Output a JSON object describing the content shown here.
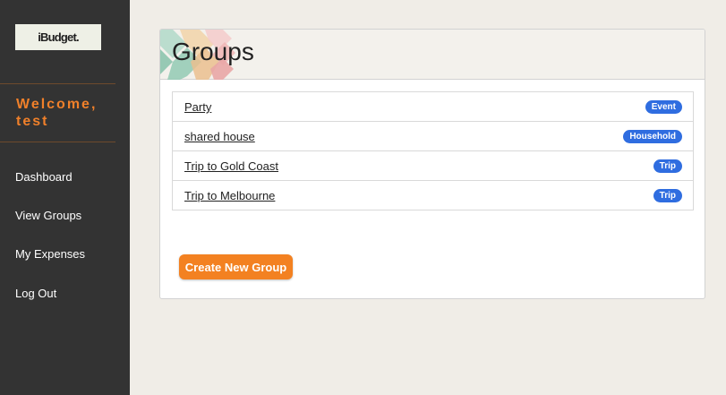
{
  "sidebar": {
    "logo": "iBudget.",
    "welcome": "Welcome, test",
    "nav": [
      {
        "label": "Dashboard"
      },
      {
        "label": "View Groups"
      },
      {
        "label": "My Expenses"
      },
      {
        "label": "Log Out"
      }
    ]
  },
  "main": {
    "title": "Groups",
    "groups": [
      {
        "name": "Party",
        "type": "Event"
      },
      {
        "name": "shared house",
        "type": "Household"
      },
      {
        "name": "Trip to Gold Coast",
        "type": "Trip"
      },
      {
        "name": "Trip to Melbourne",
        "type": "Trip"
      }
    ],
    "create_label": "Create New Group"
  },
  "colors": {
    "sidebar_bg": "#333333",
    "accent": "#f38121",
    "badge": "#2f6de0",
    "page_bg": "#f0ede7"
  }
}
